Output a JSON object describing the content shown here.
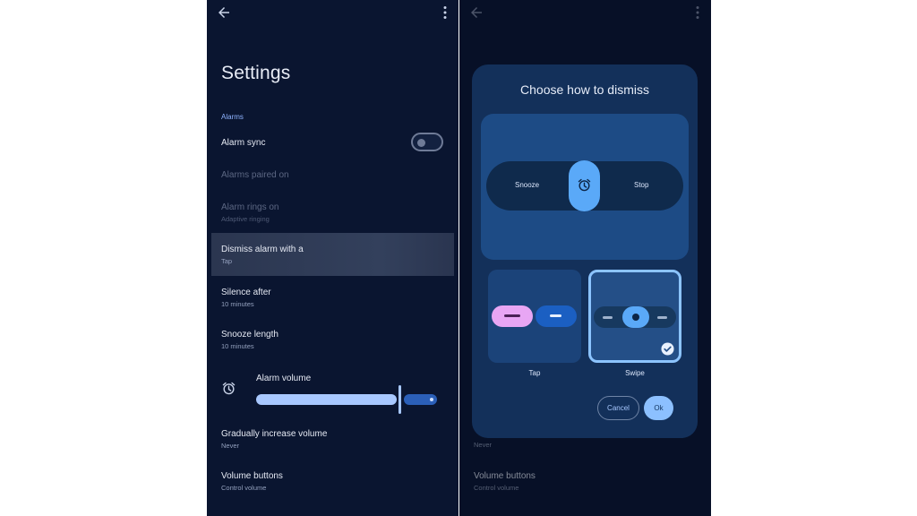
{
  "left": {
    "title": "Settings",
    "section": "Alarms",
    "items": [
      {
        "title": "Alarm sync",
        "sub": ""
      },
      {
        "title": "Alarms paired on",
        "sub": ""
      },
      {
        "title": "Alarm rings on",
        "sub": "Adaptive ringing"
      },
      {
        "title": "Dismiss alarm with a",
        "sub": "Tap"
      },
      {
        "title": "Silence after",
        "sub": "10 minutes"
      },
      {
        "title": "Snooze length",
        "sub": "10 minutes"
      },
      {
        "title": "Gradually increase volume",
        "sub": "Never"
      },
      {
        "title": "Volume buttons",
        "sub": "Control volume"
      }
    ],
    "alarm_volume": {
      "label": "Alarm volume",
      "level_fraction": 0.81
    },
    "alarm_sync_on": false
  },
  "right": {
    "items": [
      {
        "title": "Volume buttons",
        "sub": "Control volume"
      }
    ],
    "partial_sub": "Never",
    "dialog": {
      "title": "Choose how to dismiss",
      "preview": {
        "left_label": "Snooze",
        "right_label": "Stop"
      },
      "options": [
        {
          "label": "Tap",
          "selected": false
        },
        {
          "label": "Swipe",
          "selected": true
        }
      ],
      "cancel_label": "Cancel",
      "ok_label": "Ok"
    }
  },
  "colors": {
    "background": "#0a1530",
    "accent": "#a8c8ff",
    "dialog": "#13305a",
    "tap_pink": "#e8a6f4"
  },
  "icons": [
    "back-arrow-icon",
    "more-vert-icon",
    "alarm-clock-icon",
    "check-circle-icon"
  ]
}
